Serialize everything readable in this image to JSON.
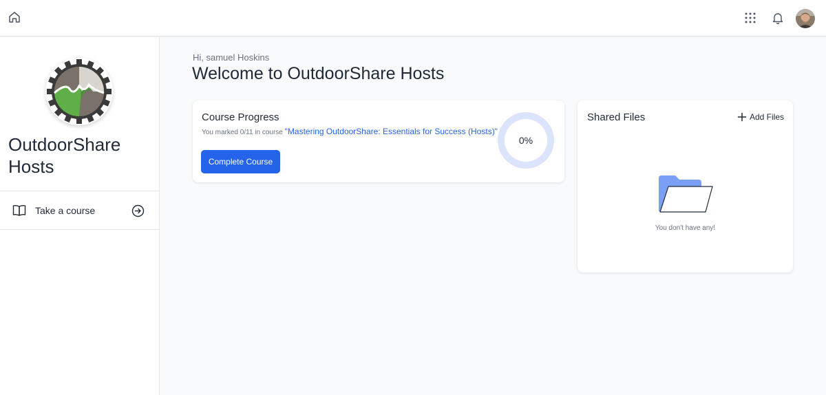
{
  "topbar": {
    "home_icon": "home-icon",
    "apps_icon": "grid-icon",
    "bell_icon": "bell-icon",
    "avatar": "user-avatar"
  },
  "sidebar": {
    "org_name": "OutdoorShare Hosts",
    "items": [
      {
        "label": "Take a course",
        "icon": "book-icon",
        "action_icon": "arrow-right-circle-icon"
      }
    ]
  },
  "main": {
    "greeting": "Hi, samuel Hoskins",
    "title": "Welcome to OutdoorShare Hosts"
  },
  "progress_card": {
    "title": "Course Progress",
    "desc_prefix": "You marked 0/11 in course ",
    "course_name": "\"Mastering OutdoorShare: Essentials for Success (Hosts)\"",
    "button_label": "Complete Course",
    "percent_label": "0%",
    "progress": 0
  },
  "files_card": {
    "title": "Shared Files",
    "add_label": "Add Files",
    "empty_text": "You don't have any!"
  },
  "colors": {
    "accent": "#2563eb",
    "ring": "#dbe4fb",
    "folder": "#7b9ff5"
  }
}
